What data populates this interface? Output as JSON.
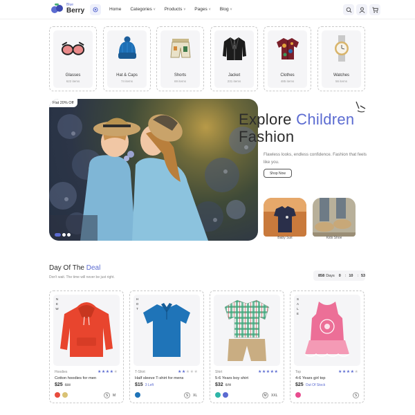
{
  "brand": {
    "small": "Blue",
    "big": "Berry"
  },
  "nav": {
    "items": [
      {
        "label": "Home",
        "has_menu": false
      },
      {
        "label": "Categories",
        "has_menu": true
      },
      {
        "label": "Products",
        "has_menu": true
      },
      {
        "label": "Pages",
        "has_menu": true
      },
      {
        "label": "Blog",
        "has_menu": true
      }
    ],
    "chevron": "˅"
  },
  "header_icons": [
    "search-icon",
    "user-icon",
    "cart-icon"
  ],
  "categories": [
    {
      "name": "Glasses",
      "count": "622 items",
      "icon": "glasses-icon"
    },
    {
      "name": "Hat & Caps",
      "count": "74 items",
      "icon": "hat-icon"
    },
    {
      "name": "Shorts",
      "count": "69 items",
      "icon": "shorts-icon"
    },
    {
      "name": "Jacket",
      "count": "231 items",
      "icon": "jacket-icon"
    },
    {
      "name": "Clothes",
      "count": "485 items",
      "icon": "shirt-icon"
    },
    {
      "name": "Watches",
      "count": "56 items",
      "icon": "watch-icon"
    }
  ],
  "hero": {
    "tag": "Flat 20% Off",
    "title_part1": "Explore",
    "title_accent": "Children",
    "title_part2": "Fashion",
    "subtitle": "Flawless looks, endless confidence. Fashion that feels like you.",
    "button": "Shop Now",
    "minis": [
      {
        "label": "Baby Suit"
      },
      {
        "label": "Kids Shoe"
      }
    ],
    "slides": 3,
    "active_slide": 1
  },
  "deal": {
    "title": "Day Of The",
    "title_accent": "Deal",
    "subtitle": "Don't wait. The time will never be just right.",
    "timer": {
      "days": "858",
      "days_label": "Days",
      "hours": "0",
      "minutes": "10",
      "seconds": "53"
    }
  },
  "products": [
    {
      "badge": "NEW",
      "category": "Hoodies",
      "rating": 4,
      "name": "Cotton hoodies for men",
      "price": "$25",
      "old_price": "$33",
      "stock": "",
      "swatches": [
        "#e84c3d",
        "#d9c274"
      ],
      "sizes": [
        "S",
        "M"
      ],
      "boxed_size": "S"
    },
    {
      "badge": "HOT",
      "category": "T-Shirt",
      "rating": 2,
      "name": "Half sleeve T-shirt for mens",
      "price": "$15",
      "old_price": "",
      "stock": "3 Left",
      "swatches": [
        "#1e73b8"
      ],
      "sizes": [
        "S",
        "XL"
      ],
      "boxed_size": "S"
    },
    {
      "badge": "",
      "category": "Shirt",
      "rating": 5,
      "name": "5-6 Years boy shirt",
      "price": "$32",
      "old_price": "$78",
      "stock": "",
      "swatches": [
        "#2fb5a8",
        "#5b6bd1"
      ],
      "sizes": [
        "M",
        "XXL"
      ],
      "boxed_size": "M"
    },
    {
      "badge": "SALE",
      "category": "Top",
      "rating": 4,
      "name": "4-6 Years girl top",
      "price": "$25",
      "old_price": "",
      "stock": "Out Of Stock",
      "swatches": [
        "#e84c8f"
      ],
      "sizes": [
        "S"
      ],
      "boxed_size": "S"
    }
  ],
  "colors": {
    "accent": "#5b6bd1",
    "text": "#2b2b2b",
    "muted": "#888888"
  }
}
